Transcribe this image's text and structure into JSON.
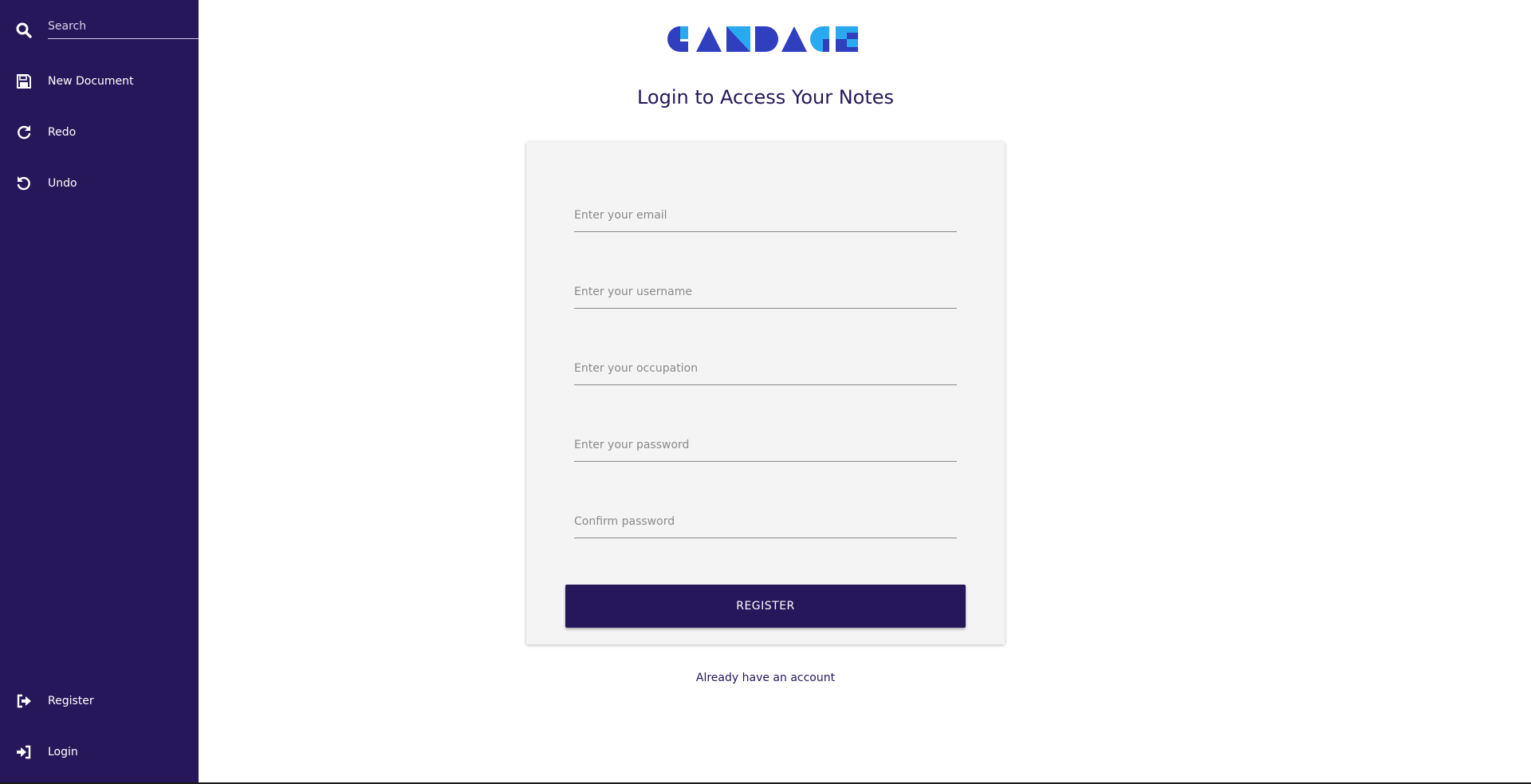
{
  "sidebar": {
    "search": {
      "placeholder": "Search",
      "icon": "search-icon"
    },
    "items": [
      {
        "label": "New Document",
        "icon": "save-icon"
      },
      {
        "label": "Redo",
        "icon": "redo-icon"
      },
      {
        "label": "Undo",
        "icon": "undo-icon"
      }
    ],
    "bottom_items": [
      {
        "label": "Register",
        "icon": "sign-out-icon"
      },
      {
        "label": "Login",
        "icon": "sign-in-icon"
      }
    ]
  },
  "main": {
    "logo_text": "CANDACE",
    "heading": "Login to Access Your Notes",
    "form": {
      "email_placeholder": "Enter your email",
      "username_placeholder": "Enter your username",
      "occupation_placeholder": "Enter your occupation",
      "password_placeholder": "Enter your password",
      "confirm_placeholder": "Confirm password",
      "submit_label": "REGISTER"
    },
    "account_link": "Already have an account"
  },
  "colors": {
    "sidebar_bg": "#26165a",
    "accent": "#26165a",
    "logo_dark": "#2f3fbf",
    "logo_light": "#29a9f0",
    "card_bg": "#f4f4f4"
  }
}
